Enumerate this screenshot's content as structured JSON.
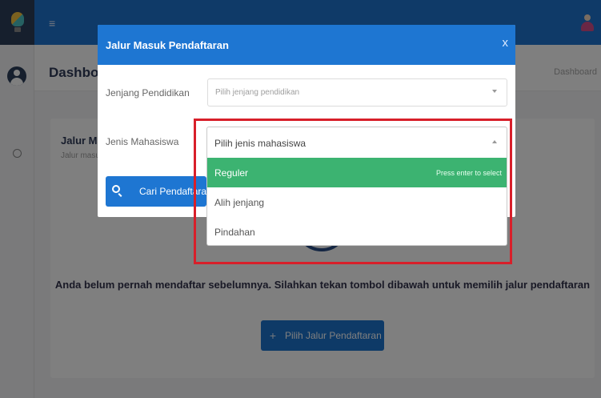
{
  "topbar": {
    "menu_icon": "hamburger-icon",
    "user_icon": "user-avatar-icon"
  },
  "sidebar": {
    "logo_icon": "lightbulb-logo-icon",
    "avatar_icon": "user-avatar-icon",
    "nav_icon": "dashboard-icon"
  },
  "header": {
    "title": "Dashboard",
    "breadcrumb": "Dashboard"
  },
  "card": {
    "title": "Jalur Masuk Pendaftaran",
    "subtitle": "Jalur masuk pendaftaran",
    "empty_message": "Anda belum pernah mendaftar sebelumnya. Silahkan tekan tombol dibawah untuk memilih jalur pendaftaran",
    "choose_button": "Pilih Jalur Pendaftaran"
  },
  "modal": {
    "title": "Jalur Masuk Pendaftaran",
    "close": "x",
    "fields": {
      "jenjang_label": "Jenjang Pendidikan",
      "jenjang_placeholder": "Pilih jenjang pendidikan",
      "jenis_label": "Jenis Mahasiswa"
    },
    "search_button": "Cari Pendaftaran"
  },
  "dropdown": {
    "selected_text": "Pilih jenis mahasiswa",
    "options": [
      {
        "label": "Reguler",
        "hint": "Press enter to select"
      },
      {
        "label": "Alih jenjang"
      },
      {
        "label": "Pindahan"
      }
    ]
  },
  "colors": {
    "primary": "#1e76d2",
    "highlight_option": "#3cb371",
    "annotation_border": "#d81f2a"
  }
}
